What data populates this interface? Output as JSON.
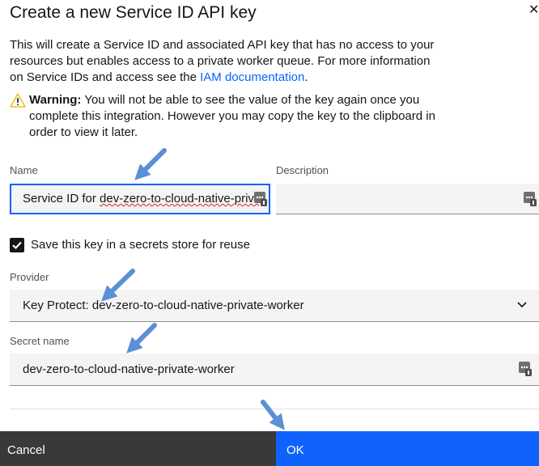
{
  "dialog": {
    "title": "Create a new Service ID API key",
    "description_pre": "This will create a Service ID and associated API key that has no access to your resources but enables access to a private worker queue. For more information on Service IDs and access see the ",
    "description_link": "IAM documentation",
    "description_post": ".",
    "warning_label": "Warning:",
    "warning_text": " You will not be able to see the value of the key again once you complete this integration. However you may copy the key to the clipboard in order to view it later."
  },
  "form": {
    "name_label": "Name",
    "name_prefix": "Service ID for ",
    "name_value_rest": "dev-zero-to-cloud-native-privat",
    "description_label": "Description",
    "description_value": "",
    "save_checkbox_label": "Save this key in a secrets store for reuse",
    "save_checked": true,
    "provider_label": "Provider",
    "provider_value": "Key Protect: dev-zero-to-cloud-native-private-worker",
    "secret_name_label": "Secret name",
    "secret_name_value": "dev-zero-to-cloud-native-private-worker"
  },
  "footer": {
    "cancel_label": "Cancel",
    "ok_label": "OK"
  },
  "colors": {
    "primary": "#0f62fe",
    "secondary_button": "#393939",
    "field_background": "#f4f4f4",
    "warning": "#f1c21b",
    "annotation_arrow": "#5b8fd6"
  },
  "icons": [
    "close-icon",
    "warning-icon",
    "password-manager-icon",
    "chevron-down-icon",
    "checkmark-icon",
    "annotation-arrow"
  ]
}
